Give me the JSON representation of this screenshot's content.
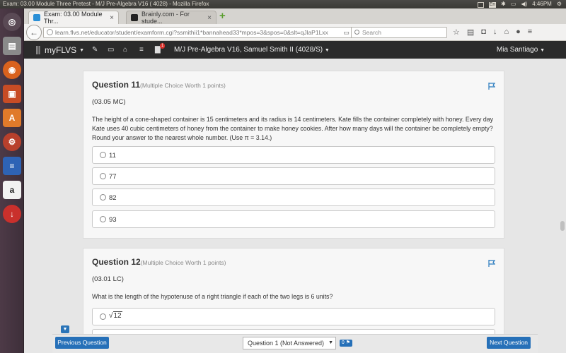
{
  "os": {
    "window_title": "Exam: 03.00 Module Three Pretest - M/J Pre-Algebra V16 ( 4028) - Mozilla Firefox",
    "keyboard_layout": "En",
    "clock": "4:46PM"
  },
  "launcher": {
    "items": [
      "ubuntu-dash-icon",
      "files-icon",
      "firefox-icon",
      "impress-icon",
      "software-center-icon",
      "settings-icon",
      "writer-icon",
      "amazon-icon",
      "update-icon"
    ],
    "colors": {
      "bg": "#4d3a47"
    }
  },
  "browser": {
    "tabs": [
      {
        "label": "Exam: 03.00 Module Thr...",
        "active": true
      },
      {
        "label": "Brainly.com - For stude...",
        "active": false
      }
    ],
    "url": "learn.flvs.net/educator/student/examform.cgi?ssmithii1*bannahead33*mpos=3&spos=0&slt=qJlaP1Lxx",
    "search_placeholder": "Search"
  },
  "site": {
    "brand": "myFLVS",
    "notification_count": "1",
    "course_title": "M/J Pre-Algebra V16, Samuel Smith II (4028/S)",
    "user_name": "Mia Santiago",
    "colors": {
      "nav_bg": "#2b2b2b",
      "accent": "#2670b8"
    }
  },
  "questions": [
    {
      "title": "Question 11",
      "worth": "(Multiple Choice Worth 1 points)",
      "code": "(03.05 MC)",
      "text": "The height of a cone-shaped container is 15 centimeters and its radius is 14 centimeters. Kate fills the container completely with honey. Every day Kate uses 40 cubic centimeters of honey from the container to make honey cookies. After how many days will the container be completely empty? Round your answer to the nearest whole number. (Use π = 3.14.)",
      "options": [
        "11",
        "77",
        "82",
        "93"
      ]
    },
    {
      "title": "Question 12",
      "worth": "(Multiple Choice Worth 1 points)",
      "code": "(03.01 LC)",
      "text": "What is the length of the hypotenuse of a right triangle if each of the two legs is 6 units?",
      "options": [
        "12"
      ]
    }
  ],
  "footer": {
    "prev_label": "Previous Question",
    "select_value": "Question 1 (Not Answered)",
    "flag_count": "0",
    "next_label": "Next Question"
  }
}
